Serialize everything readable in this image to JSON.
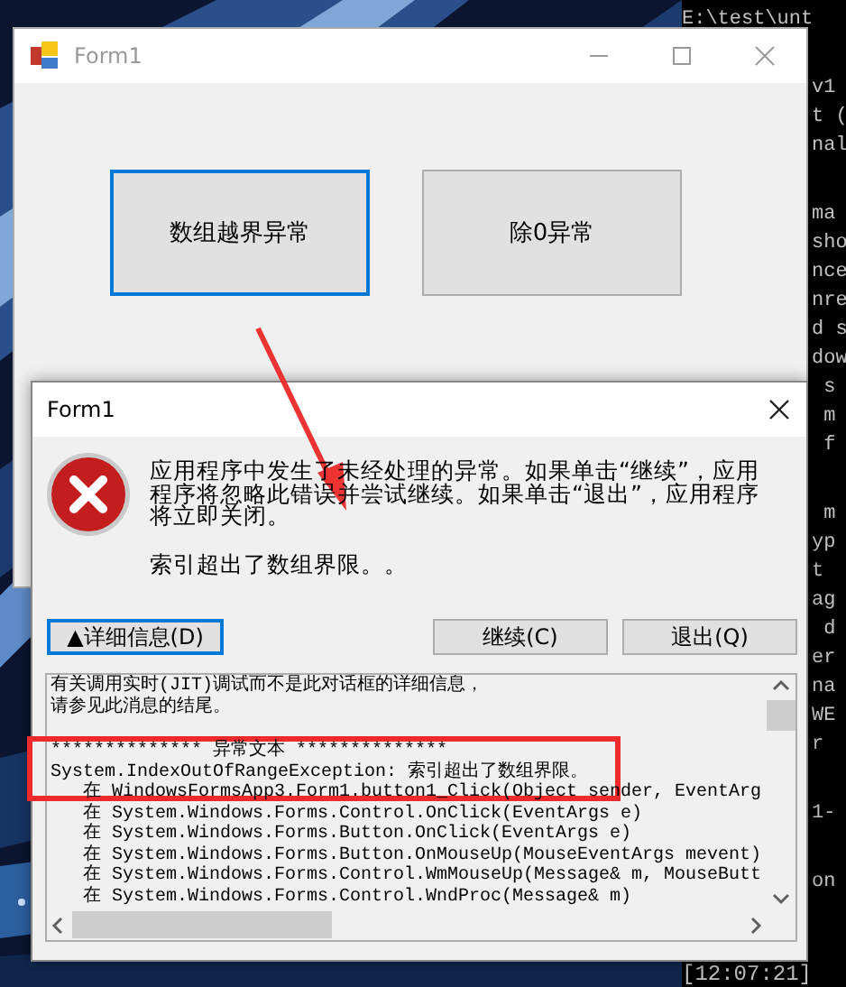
{
  "console": {
    "header": "E:\\test\\unt",
    "blocks": [
      [
        "v1",
        "t (",
        "nal"
      ],
      [
        "ma",
        "sho",
        "nce",
        "nre",
        "d s",
        "dow",
        " s",
        " m",
        " f"
      ],
      [
        " m",
        "yp",
        "t",
        "ag",
        " d",
        "er",
        "na",
        "WE",
        "r"
      ],
      [
        "1-"
      ],
      [
        "on"
      ]
    ],
    "timestamp": "[12:07:21]"
  },
  "main_window": {
    "title": "Form1",
    "buttons": [
      {
        "label": "数组越界异常",
        "focused": true
      },
      {
        "label": "除0异常",
        "focused": false
      }
    ]
  },
  "dialog": {
    "title": "Form1",
    "message": "应用程序中发生了未经处理的异常。如果单击“继续”，应用程序将忽略此错误并尝试继续。如果单击“退出”，应用程序将立即关闭。",
    "error": "索引超出了数组界限。。",
    "details_button": {
      "label": "▲详细信息(D)",
      "focused": true
    },
    "buttons": [
      "继续(C)",
      "退出(Q)"
    ],
    "details": {
      "intro": [
        "有关调用实时(JIT)调试而不是此对话框的详细信息，",
        "请参见此消息的结尾。"
      ],
      "exception": [
        "************** 异常文本 **************",
        "System.IndexOutOfRangeException: 索引超出了数组界限。",
        "   在 WindowsFormsApp3.Form1.button1_Click(Object sender, EventArg",
        "   在 System.Windows.Forms.Control.OnClick(EventArgs e)",
        "   在 System.Windows.Forms.Button.OnClick(EventArgs e)",
        "   在 System.Windows.Forms.Button.OnMouseUp(MouseEventArgs mevent)",
        "   在 System.Windows.Forms.Control.WmMouseUp(Message& m, MouseButt",
        "   在 System.Windows.Forms.Control.WndProc(Message& m)"
      ]
    }
  }
}
